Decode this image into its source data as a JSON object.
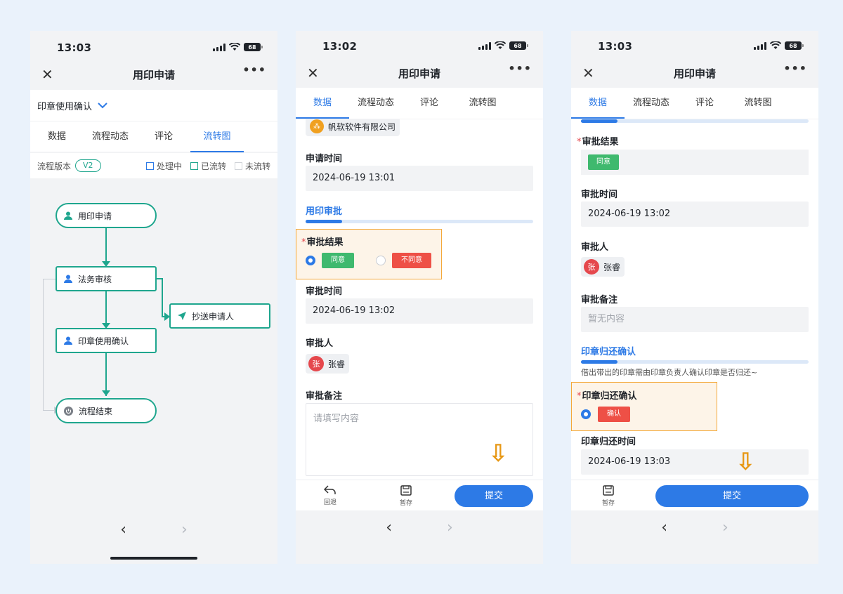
{
  "colors": {
    "accent": "#2d7ae6",
    "flow": "#1fa68e",
    "agree": "#3fb96e",
    "disagree": "#ee5046",
    "highlight": "#f4a93b"
  },
  "phone1": {
    "time": "13:03",
    "battery": "68",
    "title": "用印申请",
    "selector": "印章使用确认",
    "tabs": [
      "数据",
      "流程动态",
      "评论",
      "流转图"
    ],
    "version_label": "流程版本",
    "version": "V2",
    "legend": [
      "处理中",
      "已流转",
      "未流转"
    ],
    "nodes": [
      "用印申请",
      "法务审核",
      "抄送申请人",
      "印章使用确认",
      "流程结束"
    ]
  },
  "phone2": {
    "time": "13:02",
    "battery": "68",
    "title": "用印申请",
    "tabs": [
      "数据",
      "流程动态",
      "评论",
      "流转图"
    ],
    "company": "帆软软件有限公司",
    "apply_time_label": "申请时间",
    "apply_time": "2024-06-19 13:01",
    "section": "用印审批",
    "result_label": "审批结果",
    "agree": "同意",
    "disagree": "不同意",
    "approve_time_label": "审批时间",
    "approve_time": "2024-06-19 13:02",
    "approver_label": "审批人",
    "approver_initial": "张",
    "approver": "张睿",
    "remark_label": "审批备注",
    "remark_placeholder": "请填写内容",
    "back": "回退",
    "save": "暂存",
    "submit": "提交"
  },
  "phone3": {
    "time": "13:03",
    "battery": "68",
    "title": "用印申请",
    "tabs": [
      "数据",
      "流程动态",
      "评论",
      "流转图"
    ],
    "result_label": "审批结果",
    "result": "同意",
    "approve_time_label": "审批时间",
    "approve_time": "2024-06-19 13:02",
    "approver_label": "审批人",
    "approver_initial": "张",
    "approver": "张睿",
    "remark_label": "审批备注",
    "remark": "暂无内容",
    "section": "印章归还确认",
    "section_desc": "借出带出的印章需由印章负责人确认印章是否归还~",
    "return_label": "印章归还确认",
    "confirm": "确认",
    "return_time_label": "印章归还时间",
    "return_time": "2024-06-19 13:03",
    "save": "暂存",
    "submit": "提交"
  }
}
